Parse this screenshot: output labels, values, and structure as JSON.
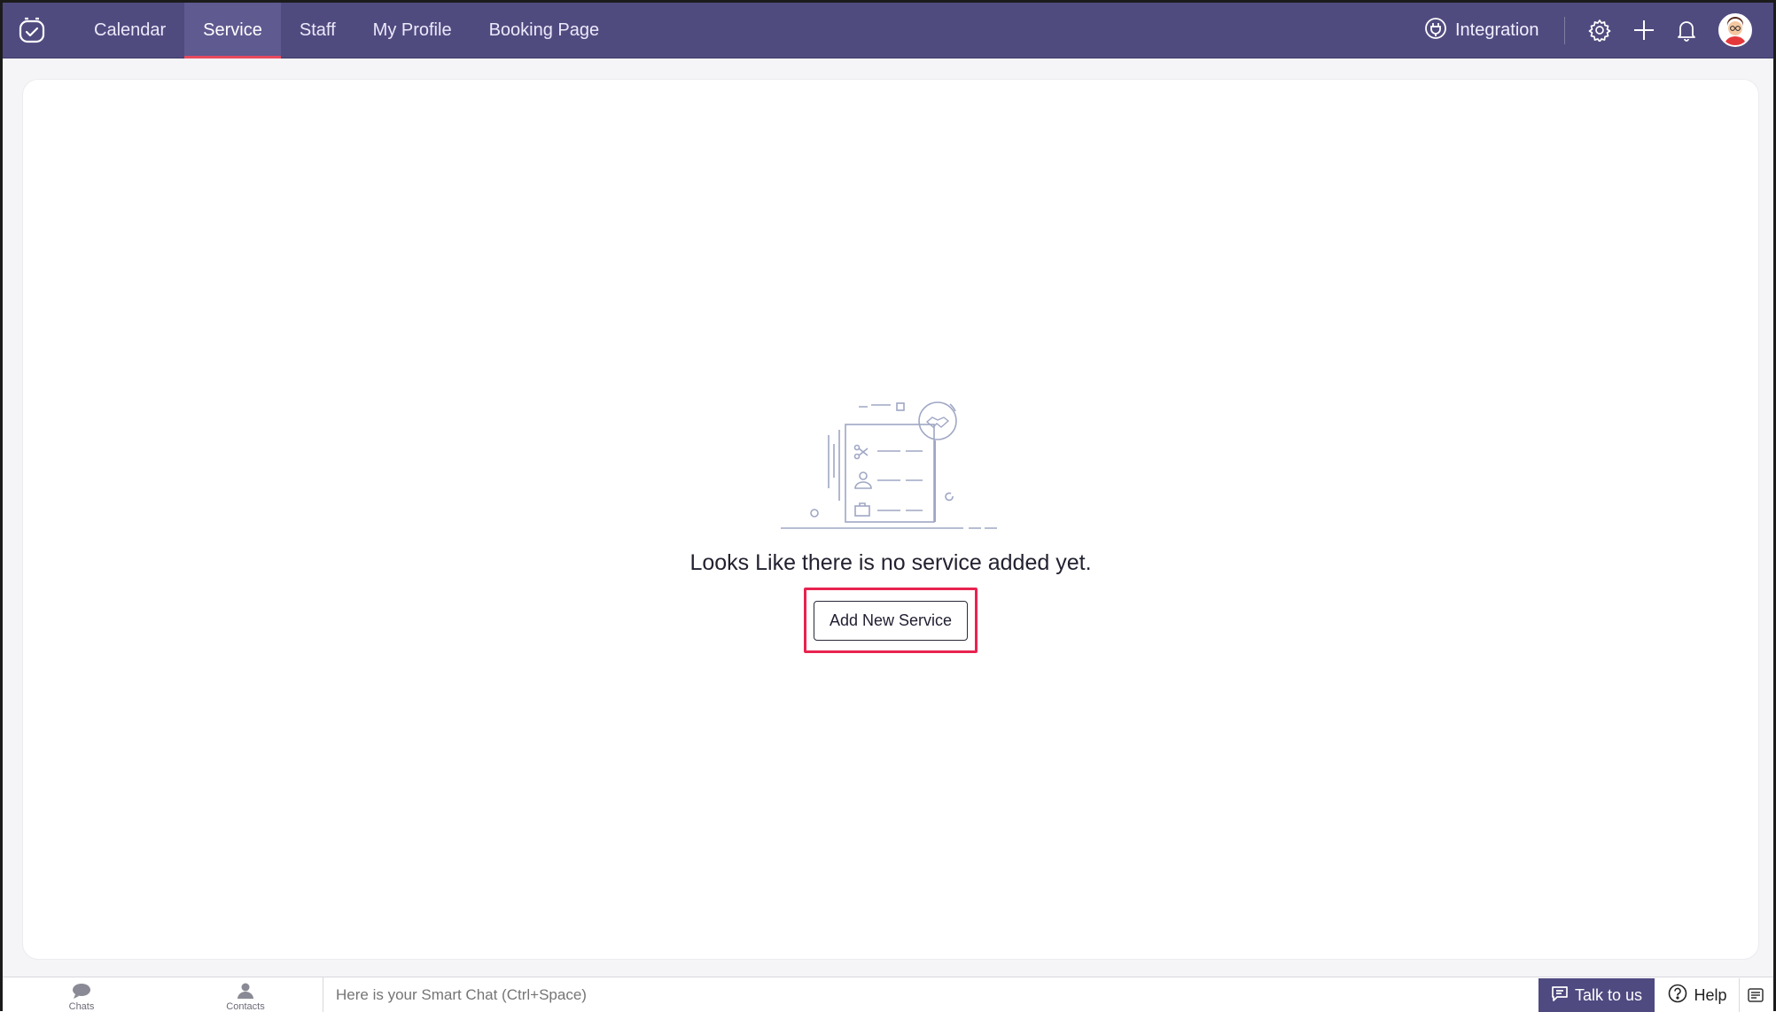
{
  "topbar": {
    "logo_icon": "app-clock-logo-icon",
    "tabs": [
      {
        "label": "Calendar",
        "active": false
      },
      {
        "label": "Service",
        "active": true
      },
      {
        "label": "Staff",
        "active": false
      },
      {
        "label": "My Profile",
        "active": false
      },
      {
        "label": "Booking Page",
        "active": false
      }
    ],
    "integration_label": "Integration",
    "icons": [
      "settings-gear-icon",
      "plus-icon",
      "bell-icon",
      "avatar"
    ],
    "active_indicator_color": "#e84a5f",
    "bar_color": "#504b7f"
  },
  "main": {
    "empty_message": "Looks Like there is no service added yet.",
    "add_button_label": "Add New Service",
    "highlight_color": "#e8234f"
  },
  "bottombar": {
    "chats_label": "Chats",
    "contacts_label": "Contacts",
    "smartchat_placeholder": "Here is your Smart Chat (Ctrl+Space)",
    "talk_label": "Talk to us",
    "help_label": "Help"
  }
}
